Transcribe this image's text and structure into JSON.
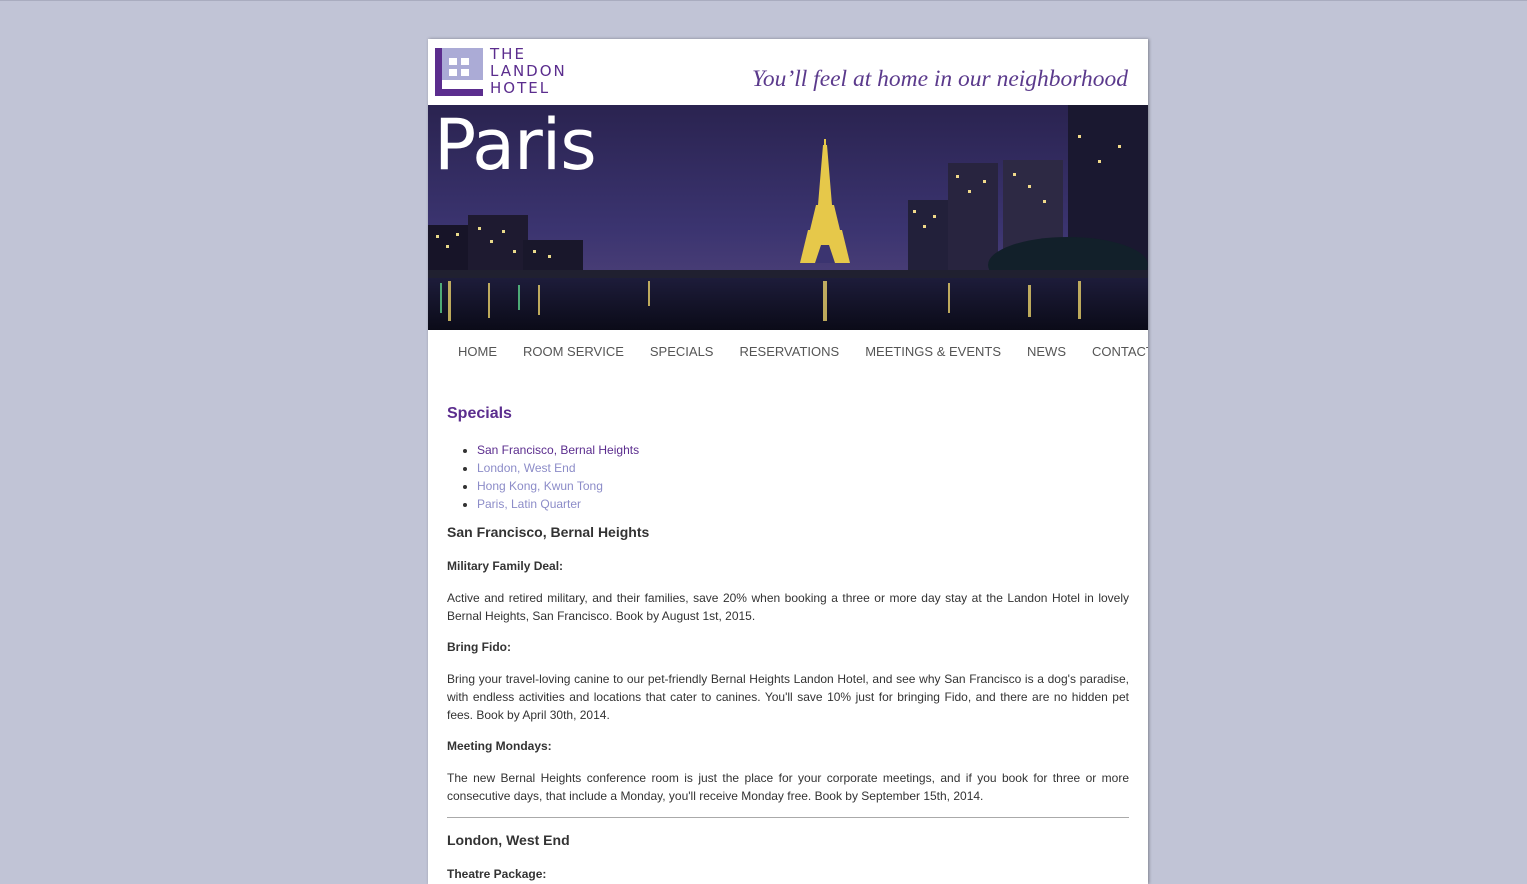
{
  "site": {
    "logo_lines": [
      "THE",
      "LANDON",
      "HOTEL"
    ],
    "tagline": "You’ll feel at home in our neighborhood",
    "hero_title": "Paris"
  },
  "nav": {
    "items": [
      "HOME",
      "ROOM SERVICE",
      "SPECIALS",
      "RESERVATIONS",
      "MEETINGS & EVENTS",
      "NEWS",
      "CONTACT"
    ]
  },
  "main": {
    "heading": "Specials",
    "jump_links": [
      "San Francisco, Bernal Heights",
      "London, West End",
      "Hong Kong, Kwun Tong",
      "Paris, Latin Quarter"
    ],
    "sf": {
      "title": "San Francisco, Bernal Heights",
      "deal1_title": "Military Family Deal:",
      "deal1_text": "Active and retired military, and their families, save 20% when booking a three or more day stay at the Landon Hotel in lovely Bernal Heights, San Francisco. Book by August 1st, 2015.",
      "deal2_title": "Bring Fido:",
      "deal2_text": "Bring your travel-loving canine to our pet-friendly Bernal Heights Landon Hotel, and see why San Francisco is a dog's paradise, with endless activities and locations that cater to canines. You'll save 10% just for bringing Fido, and there are no hidden pet fees. Book by April 30th, 2014.",
      "deal3_title": "Meeting Mondays:",
      "deal3_text": "The new Bernal Heights conference room is just the place for your corporate meetings, and if you book for three or more consecutive days, that include a Monday, you'll receive Monday free. Book by September 15th, 2014."
    },
    "london": {
      "title": "London, West End",
      "deal1_title": "Theatre Package:"
    }
  },
  "colors": {
    "page_bg": "#c1c4d6",
    "brand_purple": "#5b2d8e",
    "link_lavender": "#8c8cc8"
  }
}
